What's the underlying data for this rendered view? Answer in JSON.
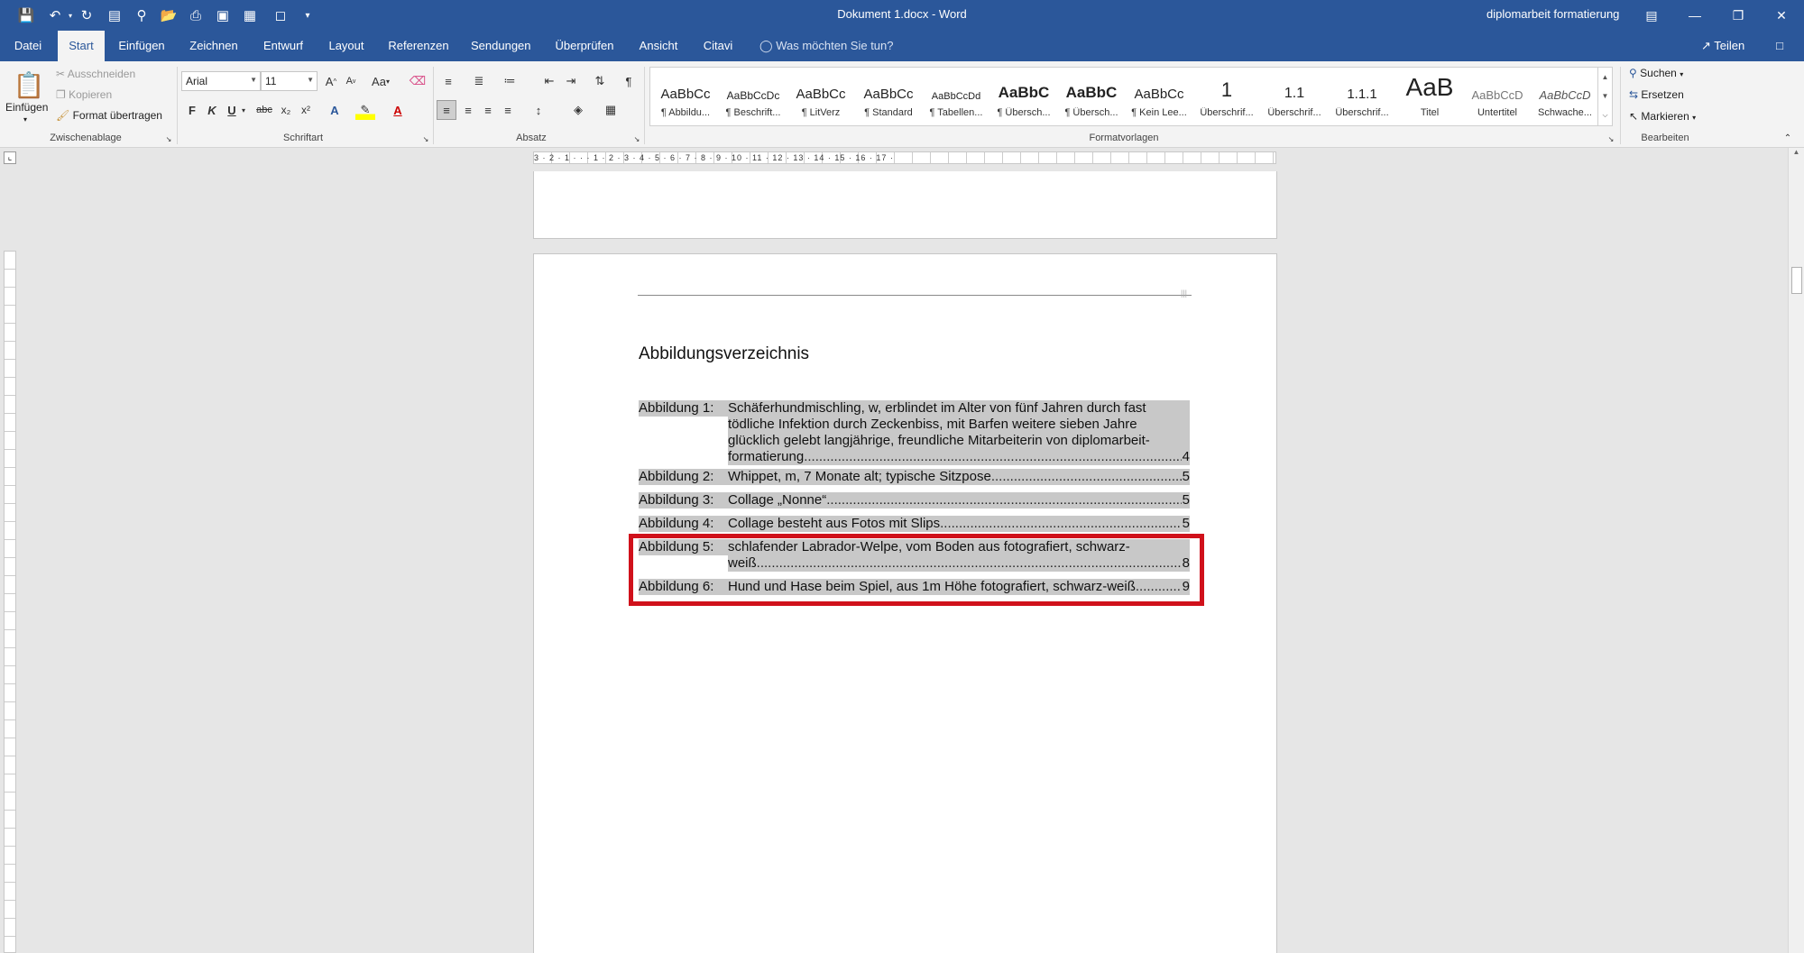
{
  "app": {
    "doc_title": "Dokument 1.docx  -  Word",
    "account": "diplomarbeit formatierung",
    "share_label": "Teilen",
    "tell_me": "Was möchten Sie tun?"
  },
  "tabs": [
    {
      "label": "Datei"
    },
    {
      "label": "Start"
    },
    {
      "label": "Einfügen"
    },
    {
      "label": "Zeichnen"
    },
    {
      "label": "Entwurf"
    },
    {
      "label": "Layout"
    },
    {
      "label": "Referenzen"
    },
    {
      "label": "Sendungen"
    },
    {
      "label": "Überprüfen"
    },
    {
      "label": "Ansicht"
    },
    {
      "label": "Citavi"
    }
  ],
  "ribbon": {
    "clipboard": {
      "paste": "Einfügen",
      "cut": "Ausschneiden",
      "copy": "Kopieren",
      "format_painter": "Format übertragen",
      "group_label": "Zwischenablage"
    },
    "font": {
      "font_name": "Arial",
      "font_size": "11",
      "change_case": "Aa",
      "bold": "F",
      "italic": "K",
      "underline": "U",
      "strike": "abc",
      "subscript": "x₂",
      "superscript": "x²",
      "group_label": "Schriftart"
    },
    "paragraph": {
      "group_label": "Absatz"
    },
    "styles": {
      "group_label": "Formatvorlagen",
      "items": [
        {
          "preview": "AaBbCc",
          "name": "¶ Abbildu..."
        },
        {
          "preview": "AaBbCcDc",
          "name": "¶ Beschrift..."
        },
        {
          "preview": "AaBbCc",
          "name": "¶ LitVerz"
        },
        {
          "preview": "AaBbCc",
          "name": "¶ Standard"
        },
        {
          "preview": "AaBbCcDd",
          "name": "¶ Tabellen..."
        },
        {
          "preview": "AaBbC",
          "name": "¶ Übersch..."
        },
        {
          "preview": "AaBbC",
          "name": "¶ Übersch..."
        },
        {
          "preview": "AaBbCc",
          "name": "¶ Kein Lee..."
        },
        {
          "preview": "1",
          "name": "Überschrif..."
        },
        {
          "preview": "1.1",
          "name": "Überschrif..."
        },
        {
          "preview": "1.1.1",
          "name": "Überschrif..."
        },
        {
          "preview": "AaB",
          "name": "Titel"
        },
        {
          "preview": "AaBbCcD",
          "name": "Untertitel"
        },
        {
          "preview": "AaBbCcD",
          "name": "Schwache..."
        }
      ]
    },
    "editing": {
      "find": "Suchen",
      "replace": "Ersetzen",
      "select": "Markieren",
      "group_label": "Bearbeiten"
    }
  },
  "ruler": {
    "h_numbers": "3 · 2 · 1 · · · 1 · 2 · 3 · 4 · 5 · 6 · 7 · 8 · 9 · 10 · 11 · 12 · 13 · 14 · 15 · 16 · 17 ·"
  },
  "document": {
    "heading": "Abbildungsverzeichnis",
    "entries": [
      {
        "label": "Abbildung 1:",
        "lines": [
          "Schäferhundmischling, w, erblindet im Alter von fünf Jahren durch fast",
          "tödliche Infektion durch Zeckenbiss, mit Barfen weitere sieben Jahre",
          "glücklich gelebt langjährige, freundliche Mitarbeiterin von diplomarbeit-"
        ],
        "last_line": "formatierung",
        "page": "4"
      },
      {
        "label": "Abbildung 2:",
        "lines": [],
        "last_line": "Whippet, m, 7 Monate alt; typische Sitzpose",
        "page": "5"
      },
      {
        "label": "Abbildung 3:",
        "lines": [],
        "last_line": "Collage „Nonne“",
        "page": "5"
      },
      {
        "label": "Abbildung 4:",
        "lines": [],
        "last_line": "Collage besteht aus Fotos mit Slips",
        "page": "5"
      },
      {
        "label": "Abbildung 5:",
        "lines": [
          "schlafender Labrador-Welpe, vom Boden aus fotografiert, schwarz-"
        ],
        "last_line": "weiß",
        "page": "8"
      },
      {
        "label": "Abbildung 6:",
        "lines": [],
        "last_line": "Hund und Hase beim Spiel, aus 1m Höhe fotografiert, schwarz-weiß",
        "page": "9"
      }
    ],
    "dot_leader": "..............................................................................................................................................................................................................."
  },
  "colors": {
    "brand": "#2b579a",
    "highlight_box": "#d0111b",
    "selection": "#c8c8c8"
  }
}
